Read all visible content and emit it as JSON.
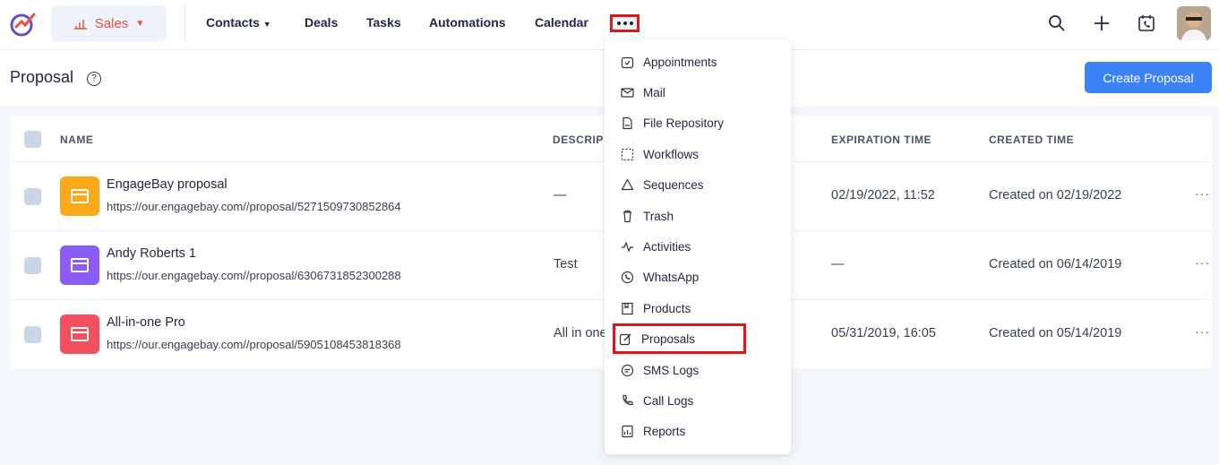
{
  "nav": {
    "sales_label": "Sales",
    "links": [
      "Contacts",
      "Deals",
      "Tasks",
      "Automations",
      "Calendar"
    ]
  },
  "page": {
    "title": "Proposal",
    "help": "?",
    "create_button": "Create Proposal"
  },
  "table": {
    "headers": [
      "NAME",
      "DESCRIP",
      "EXPIRATION TIME",
      "CREATED TIME"
    ],
    "rows": [
      {
        "name": "EngageBay proposal",
        "url": "https://our.engagebay.com//proposal/5271509730852864",
        "description": "—",
        "expiration": "02/19/2022, 11:52",
        "created": "Created on 02/19/2022",
        "icon_color": "#fba919"
      },
      {
        "name": "Andy Roberts 1",
        "url": "https://our.engagebay.com//proposal/6306731852300288",
        "description": "Test",
        "expiration": "—",
        "created": "Created on 06/14/2019",
        "icon_color": "#8b5cf6"
      },
      {
        "name": "All-in-one Pro",
        "url": "https://our.engagebay.com//proposal/5905108453818368",
        "description": "All in one",
        "expiration": "05/31/2019, 16:05",
        "created": "Created on 05/14/2019",
        "icon_color": "#f2505f"
      }
    ],
    "row_more": "···"
  },
  "dropdown": {
    "items": [
      {
        "label": "Appointments",
        "icon": "calendar-check-icon"
      },
      {
        "label": "Mail",
        "icon": "mail-icon"
      },
      {
        "label": "File Repository",
        "icon": "file-icon"
      },
      {
        "label": "Workflows",
        "icon": "workflow-icon"
      },
      {
        "label": "Sequences",
        "icon": "sequence-icon"
      },
      {
        "label": "Trash",
        "icon": "trash-icon"
      },
      {
        "label": "Activities",
        "icon": "activity-icon"
      },
      {
        "label": "WhatsApp",
        "icon": "whatsapp-icon"
      },
      {
        "label": "Products",
        "icon": "product-icon"
      },
      {
        "label": "Proposals",
        "icon": "edit-icon"
      },
      {
        "label": "SMS Logs",
        "icon": "sms-icon"
      },
      {
        "label": "Call Logs",
        "icon": "phone-icon"
      },
      {
        "label": "Reports",
        "icon": "report-icon"
      }
    ],
    "active_item": "Proposals"
  },
  "colors": {
    "accent": "#3b82f6",
    "brand_orange": "#e8513a",
    "highlight": "#e0161d"
  }
}
